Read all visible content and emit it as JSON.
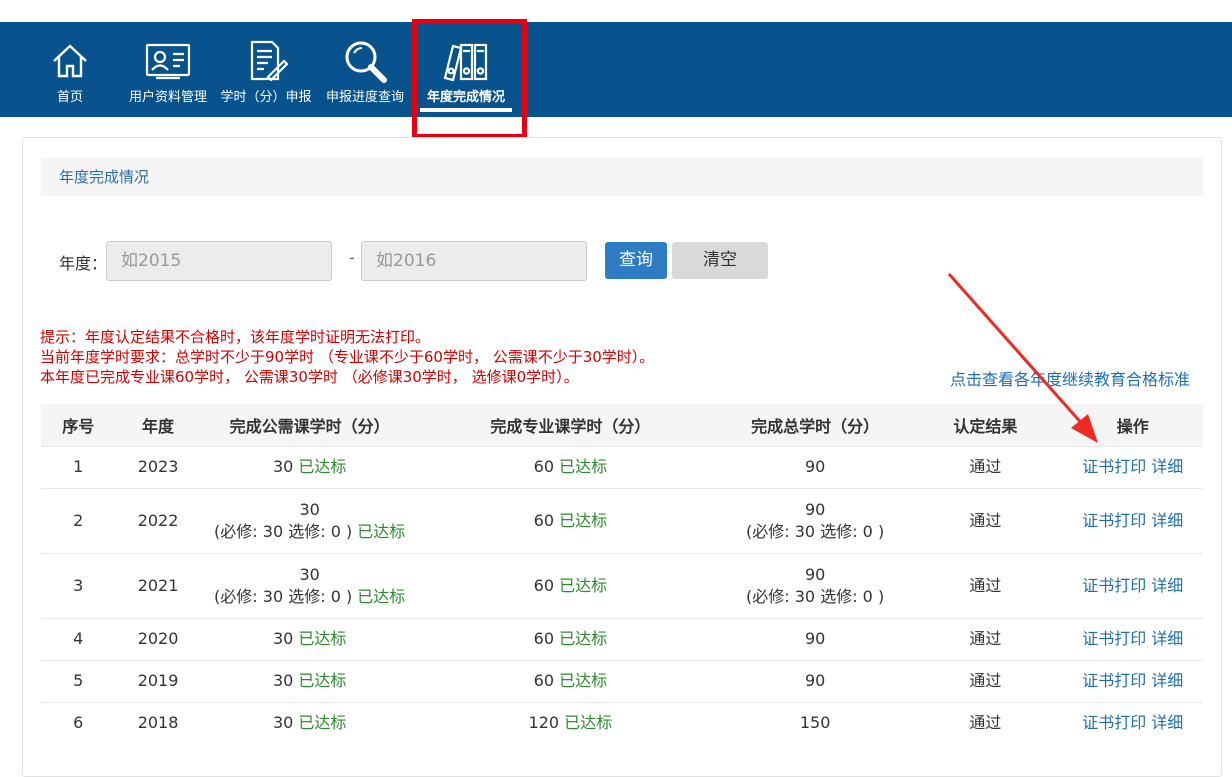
{
  "nav": {
    "items": [
      {
        "label": "首页",
        "icon": "home-icon"
      },
      {
        "label": "用户资料管理",
        "icon": "id-card-icon"
      },
      {
        "label": "学时（分）申报",
        "icon": "document-pen-icon"
      },
      {
        "label": "申报进度查询",
        "icon": "magnifier-icon"
      },
      {
        "label": "年度完成情况",
        "icon": "binders-icon"
      }
    ],
    "active_index": 4
  },
  "panel": {
    "title": "年度完成情况"
  },
  "filter": {
    "label": "年度：",
    "from_placeholder": "如2015",
    "separator": "-",
    "to_placeholder": "如2016",
    "query_label": "查询",
    "clear_label": "清空"
  },
  "notices": [
    "提示：年度认定结果不合格时，该年度学时证明无法打印。",
    "当前年度学时要求：总学时不少于90学时 （专业课不少于60学时， 公需课不少于30学时）。",
    "本年度已完成专业课60学时， 公需课30学时 （必修课30学时， 选修课0学时）。"
  ],
  "standard_link": "点击查看各年度继续教育合格标准",
  "table": {
    "headers": [
      "序号",
      "年度",
      "完成公需课学时（分）",
      "完成专业课学时（分）",
      "完成总学时（分）",
      "认定结果",
      "操作"
    ],
    "rows": [
      {
        "no": "1",
        "year": "2023",
        "public": "30",
        "public_detail": "",
        "public_status": "已达标",
        "prof": "60",
        "prof_status": "已达标",
        "total": "90",
        "total_detail": "",
        "result": "通过",
        "op1": "证书打印",
        "op2": "详细"
      },
      {
        "no": "2",
        "year": "2022",
        "public": "30",
        "public_detail": "(必修: 30 选修: 0 )",
        "public_status": "已达标",
        "prof": "60",
        "prof_status": "已达标",
        "total": "90",
        "total_detail": "(必修: 30 选修: 0 )",
        "result": "通过",
        "op1": "证书打印",
        "op2": "详细"
      },
      {
        "no": "3",
        "year": "2021",
        "public": "30",
        "public_detail": "(必修: 30 选修: 0 )",
        "public_status": "已达标",
        "prof": "60",
        "prof_status": "已达标",
        "total": "90",
        "total_detail": "(必修: 30 选修: 0 )",
        "result": "通过",
        "op1": "证书打印",
        "op2": "详细"
      },
      {
        "no": "4",
        "year": "2020",
        "public": "30",
        "public_detail": "",
        "public_status": "已达标",
        "prof": "60",
        "prof_status": "已达标",
        "total": "90",
        "total_detail": "",
        "result": "通过",
        "op1": "证书打印",
        "op2": "详细"
      },
      {
        "no": "5",
        "year": "2019",
        "public": "30",
        "public_detail": "",
        "public_status": "已达标",
        "prof": "60",
        "prof_status": "已达标",
        "total": "90",
        "total_detail": "",
        "result": "通过",
        "op1": "证书打印",
        "op2": "详细"
      },
      {
        "no": "6",
        "year": "2018",
        "public": "30",
        "public_detail": "",
        "public_status": "已达标",
        "prof": "120",
        "prof_status": "已达标",
        "total": "150",
        "total_detail": "",
        "result": "通过",
        "op1": "证书打印",
        "op2": "详细"
      }
    ]
  },
  "colors": {
    "nav_bg": "#08538e",
    "highlight": "#e6000f",
    "ok": "#2e8b2e",
    "link": "#1f6fb0",
    "notice": "#d40000",
    "query_btn": "#2e7cc4"
  }
}
